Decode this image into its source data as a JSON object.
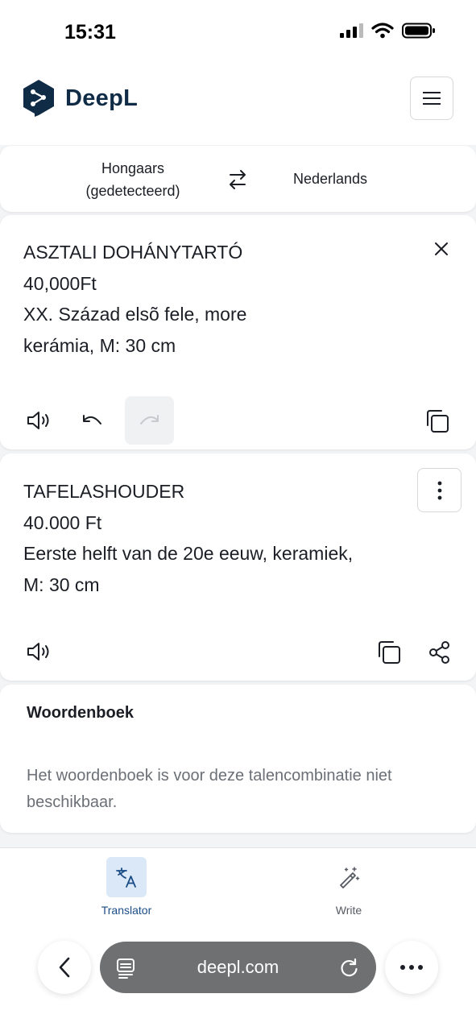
{
  "status": {
    "time": "15:31"
  },
  "app": {
    "name": "DeepL"
  },
  "languages": {
    "source": "Hongaars (gedetecteerd)",
    "target": "Nederlands"
  },
  "source": {
    "lines": [
      "ASZTALI DOHÁNYTARTÓ",
      "40,000Ft",
      "XX. Század elsõ fele, more",
      "kerámia, M: 30 cm"
    ]
  },
  "target": {
    "lines": [
      "TAFELASHOUDER",
      "40.000 Ft",
      "Eerste helft van de 20e eeuw, keramiek,",
      "M: 30 cm"
    ]
  },
  "dictionary": {
    "title": "Woordenboek",
    "message": "Het woordenboek is voor deze talencombinatie niet beschikbaar."
  },
  "nav": {
    "translator_label": "Translator",
    "write_label": "Write"
  },
  "browser": {
    "url": "deepl.com"
  },
  "colors": {
    "accent": "#0f2b46",
    "nav_active": "#1a4c86",
    "nav_active_bg": "#dbe8f7",
    "muted": "#6b6f76"
  },
  "icons": {
    "logo": "deepl-logo-icon",
    "menu": "hamburger-menu-icon",
    "swap": "swap-arrows-icon",
    "close": "close-icon",
    "speaker": "speaker-icon",
    "undo": "undo-icon",
    "redo": "redo-icon",
    "copy": "copy-icon",
    "more": "more-vertical-icon",
    "share": "share-icon",
    "translator": "translate-icon",
    "write": "magic-wand-icon",
    "back": "chevron-left-icon",
    "reader": "reader-mode-icon",
    "reload": "reload-icon",
    "browser_more": "more-horizontal-icon"
  }
}
